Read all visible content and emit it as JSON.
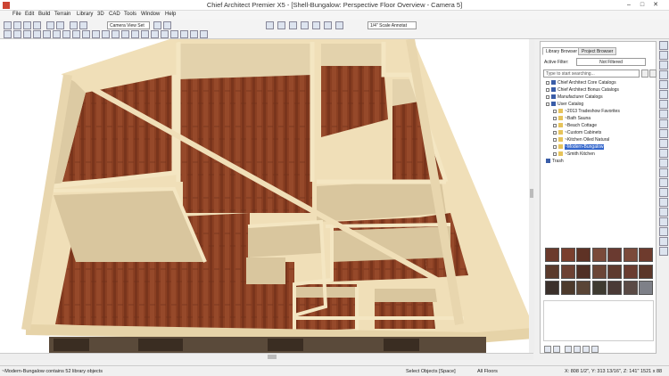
{
  "window": {
    "title": "Chief Architect Premier X5 - [Shell-Bungalow: Perspective Floor Overview - Camera 5]",
    "minimize": "–",
    "maximize": "□",
    "close": "✕"
  },
  "menu": [
    "File",
    "Edit",
    "Build",
    "Terrain",
    "Library",
    "3D",
    "CAD",
    "Tools",
    "Window",
    "Help"
  ],
  "toolbar": {
    "camera_select": "Camera View Set",
    "scale_select": "1/4\" Scale Annotat"
  },
  "library": {
    "tabs": [
      "Library Browser",
      "Project Browser"
    ],
    "active_filter_label": "Active Filter:",
    "active_filter_value": "Not Filtered",
    "search_placeholder": "Type to start searching...",
    "tree": [
      {
        "label": "Chief Architect Core Catalogs",
        "level": 0
      },
      {
        "label": "Chief Architect Bonus Catalogs",
        "level": 0
      },
      {
        "label": "Manufacturer Catalogs",
        "level": 0
      },
      {
        "label": "User Catalog",
        "level": 0
      },
      {
        "label": "2013 Tradeshow Favorites",
        "level": 1
      },
      {
        "label": "Bath Sauna",
        "level": 1
      },
      {
        "label": "Beach Cottage",
        "level": 1
      },
      {
        "label": "Custom Cabinets",
        "level": 1
      },
      {
        "label": "Kitchen Oiled Natural",
        "level": 1
      },
      {
        "label": "Modern-Bungalow",
        "level": 1,
        "selected": true
      },
      {
        "label": "Smith Kitchen",
        "level": 1
      },
      {
        "label": "Trash",
        "level": 0
      }
    ],
    "swatch_colors": [
      "#6b3a2c",
      "#7a3f2e",
      "#5e3225",
      "#7a4a3a",
      "#6a3a30",
      "#7b4a3a",
      "#6e3b2d",
      "#5a3a2c",
      "#6d4133",
      "#4f2f25",
      "#6b4536",
      "#5e3a2e",
      "#6a3c30",
      "#5b3629",
      "#3b302b",
      "#4d3a2c",
      "#5a4536",
      "#3e3a30",
      "#4a3a36",
      "#5a4a45",
      "#7e8088"
    ]
  },
  "status": {
    "left": "~Modern-Bungalow contains 52 library objects",
    "mode": "Select Objects [Space]",
    "floor": "All Floors",
    "coords": "X: 808 1/2\", Y: 313 13/16\", Z: 141\"   1521 x 88"
  },
  "colors": {
    "wood_floor": "#8a3f22",
    "wall_top": "#f0dfb8",
    "wall_face": "#dccaa3",
    "selection": "#3366cc"
  }
}
